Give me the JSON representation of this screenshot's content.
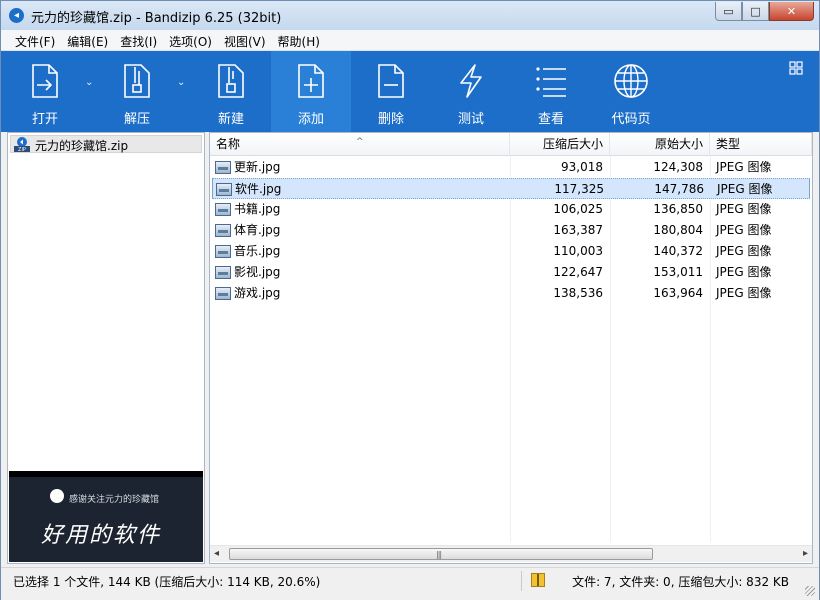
{
  "window": {
    "title": "元力的珍藏馆.zip - Bandizip 6.25 (32bit)",
    "min_label": "▭",
    "max_label": "□",
    "close_label": "✕"
  },
  "menu": [
    "文件(F)",
    "编辑(E)",
    "查找(I)",
    "选项(O)",
    "视图(V)",
    "帮助(H)"
  ],
  "toolbar": {
    "accent": "#1d6ec8",
    "buttons": [
      {
        "label": "打开",
        "icon": "open-icon"
      },
      {
        "label": "解压",
        "icon": "extract-icon"
      },
      {
        "label": "新建",
        "icon": "new-archive-icon"
      },
      {
        "label": "添加",
        "icon": "add-file-icon",
        "active": true
      },
      {
        "label": "删除",
        "icon": "delete-icon"
      },
      {
        "label": "测试",
        "icon": "test-icon"
      },
      {
        "label": "查看",
        "icon": "view-list-icon"
      },
      {
        "label": "代码页",
        "icon": "globe-icon"
      }
    ]
  },
  "tree": {
    "root": "元力的珍藏馆.zip"
  },
  "banner": {
    "small_text": "感谢关注元力的珍藏馆",
    "big_text": "好用的软件"
  },
  "list": {
    "columns": [
      "名称",
      "压缩后大小",
      "原始大小",
      "类型"
    ],
    "sort_indicator": "^",
    "rows": [
      {
        "name": "更新.jpg",
        "packed": "93,018",
        "size": "124,308",
        "type": "JPEG 图像",
        "selected": false
      },
      {
        "name": "软件.jpg",
        "packed": "117,325",
        "size": "147,786",
        "type": "JPEG 图像",
        "selected": true
      },
      {
        "name": "书籍.jpg",
        "packed": "106,025",
        "size": "136,850",
        "type": "JPEG 图像",
        "selected": false
      },
      {
        "name": "体育.jpg",
        "packed": "163,387",
        "size": "180,804",
        "type": "JPEG 图像",
        "selected": false
      },
      {
        "name": "音乐.jpg",
        "packed": "110,003",
        "size": "140,372",
        "type": "JPEG 图像",
        "selected": false
      },
      {
        "name": "影视.jpg",
        "packed": "122,647",
        "size": "153,011",
        "type": "JPEG 图像",
        "selected": false
      },
      {
        "name": "游戏.jpg",
        "packed": "138,536",
        "size": "163,964",
        "type": "JPEG 图像",
        "selected": false
      }
    ]
  },
  "status": {
    "left": "已选择 1 个文件, 144 KB (压缩后大小: 114 KB, 20.6%)",
    "right": "文件: 7, 文件夹: 0, 压缩包大小: 832 KB"
  }
}
